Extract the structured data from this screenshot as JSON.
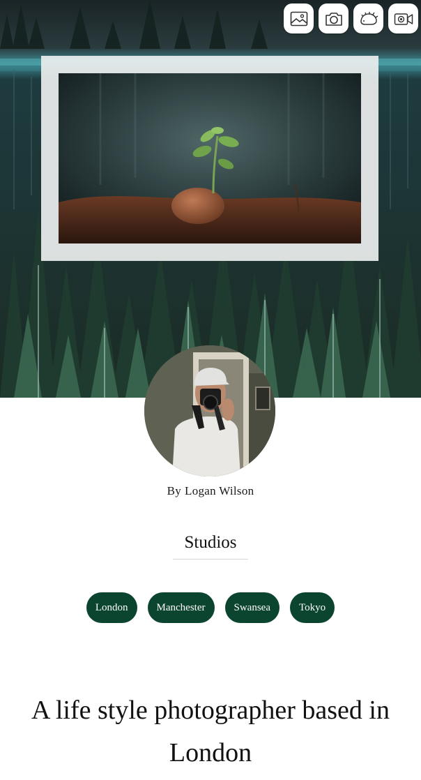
{
  "toolbar": {
    "buttons": [
      {
        "icon": "image-icon"
      },
      {
        "icon": "camera-icon"
      },
      {
        "icon": "hedgehog-icon"
      },
      {
        "icon": "video-camera-icon"
      }
    ]
  },
  "profile": {
    "byline_prefix": "By",
    "author": "Logan Wilson"
  },
  "studios": {
    "title": "Studios",
    "items": [
      "London",
      "Manchester",
      "Swansea",
      "Tokyo"
    ]
  },
  "headline": "A life style photographer based in London",
  "colors": {
    "pill_background": "#0b4530",
    "pill_text": "#ffffff",
    "toolbar_button": "#ffffff"
  }
}
